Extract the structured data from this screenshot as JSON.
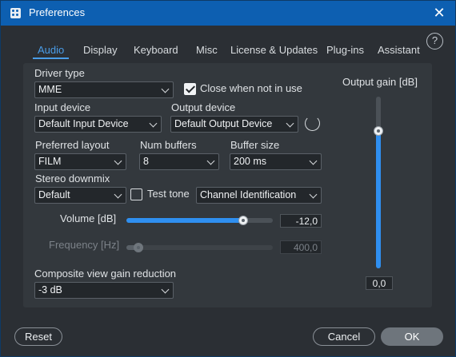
{
  "window": {
    "title": "Preferences"
  },
  "tabs": [
    {
      "label": "Audio",
      "active": true
    },
    {
      "label": "Display"
    },
    {
      "label": "Keyboard"
    },
    {
      "label": "Misc"
    },
    {
      "label": "License & Updates"
    },
    {
      "label": "Plug-ins"
    },
    {
      "label": "Assistant"
    }
  ],
  "help_label": "?",
  "driver": {
    "label": "Driver type",
    "value": "MME"
  },
  "close_when_not_in_use": {
    "label": "Close when not in use",
    "checked": true
  },
  "input_device": {
    "label": "Input device",
    "value": "Default Input Device"
  },
  "output_device": {
    "label": "Output device",
    "value": "Default Output Device"
  },
  "preferred_layout": {
    "label": "Preferred layout",
    "value": "FILM"
  },
  "num_buffers": {
    "label": "Num buffers",
    "value": "8"
  },
  "buffer_size": {
    "label": "Buffer size",
    "value": "200 ms"
  },
  "stereo_downmix": {
    "label": "Stereo downmix",
    "value": "Default"
  },
  "test_tone": {
    "label": "Test tone",
    "checked": false,
    "mode": "Channel Identification"
  },
  "volume": {
    "label": "Volume [dB]",
    "value": "-12,0",
    "fraction": 0.8
  },
  "frequency": {
    "label": "Frequency [Hz]",
    "value": "400,0",
    "fraction": 0.08,
    "enabled": false
  },
  "composite": {
    "label": "Composite view gain reduction",
    "value": "-3 dB"
  },
  "output_gain": {
    "label": "Output gain [dB]",
    "value": "0,0",
    "fraction": 0.8
  },
  "buttons": {
    "reset": "Reset",
    "cancel": "Cancel",
    "ok": "OK"
  },
  "colors": {
    "title_bar": "#0d5fb1",
    "accent": "#2f8ff0",
    "active_tab": "#4a9de8"
  }
}
